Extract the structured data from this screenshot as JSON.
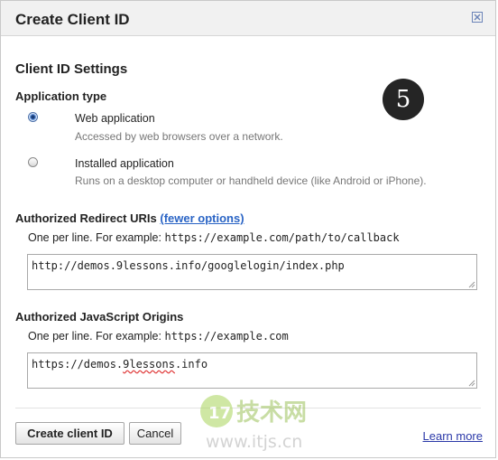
{
  "dialog": {
    "title": "Create Client ID"
  },
  "settings": {
    "section_title": "Client ID Settings",
    "app_type_label": "Application type",
    "options": [
      {
        "label": "Web application",
        "description": "Accessed by web browsers over a network.",
        "selected": true
      },
      {
        "label": "Installed application",
        "description": "Runs on a desktop computer or handheld device (like Android or iPhone).",
        "selected": false
      }
    ],
    "step_number": "5"
  },
  "redirect": {
    "heading": "Authorized Redirect URIs",
    "toggle_link": "(fewer options)",
    "hint_text": "One per line. For example:",
    "hint_example": "https://example.com/path/to/callback",
    "value": "http://demos.9lessons.info/googlelogin/index.php"
  },
  "origins": {
    "heading": "Authorized JavaScript Origins",
    "hint_text": "One per line. For example:",
    "hint_example": "https://example.com",
    "value_prefix": "https://demos.",
    "value_misspelled": "9lessons",
    "value_suffix": ".info"
  },
  "footer": {
    "create_label": "Create client ID",
    "cancel_label": "Cancel",
    "learn_more_label": "Learn more"
  },
  "watermark": {
    "cn_text": "技术网",
    "url_text": "www.itjs.cn"
  },
  "colors": {
    "link": "#2a64c5",
    "titlebar": "#f1f1f1",
    "badge": "#252525"
  }
}
